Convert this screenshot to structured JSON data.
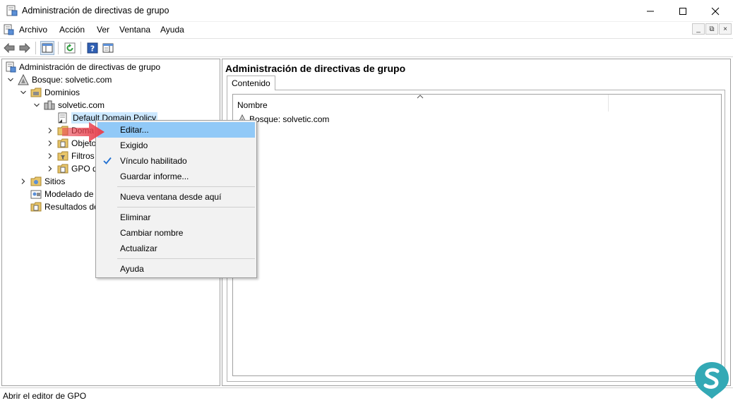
{
  "window": {
    "title": "Administración de directivas de grupo",
    "controls": {
      "minimize": "—",
      "maximize": "☐",
      "close": "✕"
    }
  },
  "menubar": {
    "items": [
      "Archivo",
      "Acción",
      "Ver",
      "Ventana",
      "Ayuda"
    ]
  },
  "tree": {
    "root": "Administración de directivas de grupo",
    "forest": "Bosque: solvetic.com",
    "domains": "Dominios",
    "domain": "solvetic.com",
    "gpo_link": "Default Domain Policy",
    "child_1": "Doma",
    "child_2": "Objeto",
    "child_3": "Filtros",
    "child_4": "GPO d",
    "sites": "Sitios",
    "modeling": "Modelado de",
    "results": "Resultados de"
  },
  "right_pane": {
    "title": "Administración de directivas de grupo",
    "tab": "Contenido",
    "column_header": "Nombre",
    "rows": [
      "Bosque: solvetic.com"
    ]
  },
  "context_menu": {
    "items": [
      {
        "label": "Editar...",
        "highlighted": true
      },
      {
        "label": "Exigido"
      },
      {
        "label": "Vínculo habilitado",
        "checked": true
      },
      {
        "label": "Guardar informe..."
      },
      {
        "label": "Nueva ventana desde aquí"
      },
      {
        "label": "Eliminar"
      },
      {
        "label": "Cambiar nombre"
      },
      {
        "label": "Actualizar"
      },
      {
        "label": "Ayuda"
      }
    ]
  },
  "statusbar": {
    "text": "Abrir el editor de GPO"
  },
  "colors": {
    "highlight": "#91c9f7",
    "selection": "#cce8ff",
    "annotation_arrow": "#e8424f",
    "logo": "#33a9b5"
  }
}
